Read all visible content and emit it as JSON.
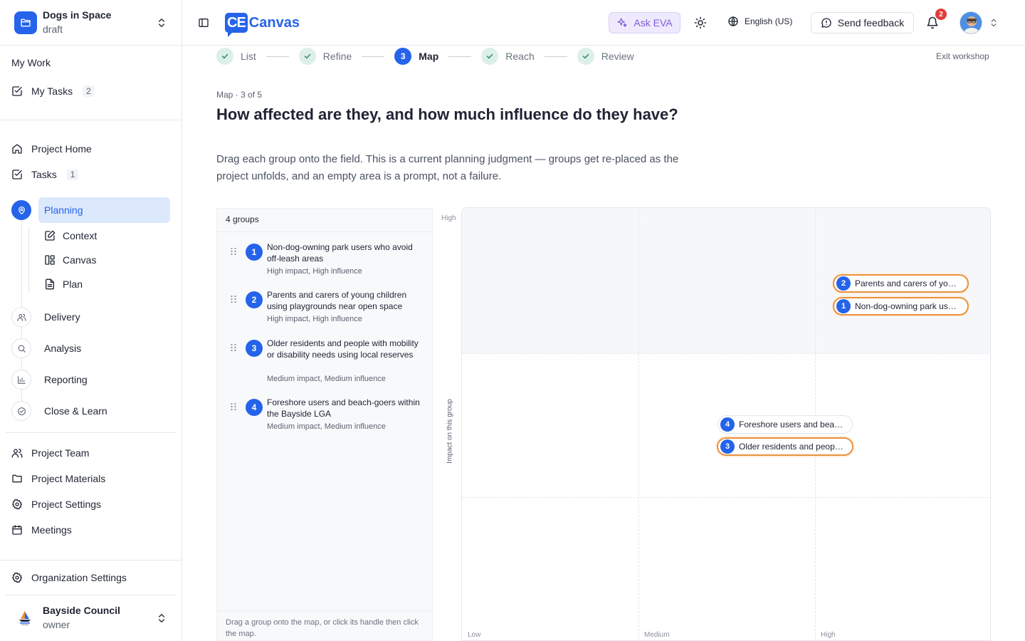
{
  "project": {
    "name": "Dogs in Space",
    "status": "draft"
  },
  "sidebar": {
    "section_label": "My Work",
    "my_tasks": {
      "label": "My Tasks",
      "count": "2"
    },
    "project_home": "Project Home",
    "tasks": {
      "label": "Tasks",
      "count": "1"
    },
    "phases": [
      {
        "label": "Planning",
        "icon": "map-pin-icon",
        "active": true
      },
      {
        "label": "Delivery",
        "icon": "users-icon"
      },
      {
        "label": "Analysis",
        "icon": "search-icon"
      },
      {
        "label": "Reporting",
        "icon": "bar-chart-icon"
      },
      {
        "label": "Close & Learn",
        "icon": "check-circle-icon"
      }
    ],
    "planning_children": [
      {
        "label": "Context",
        "icon": "edit-icon"
      },
      {
        "label": "Canvas",
        "icon": "layout-icon"
      },
      {
        "label": "Plan",
        "icon": "document-icon"
      }
    ],
    "links": [
      {
        "label": "Project Team",
        "icon": "users-icon"
      },
      {
        "label": "Project Materials",
        "icon": "folder-icon"
      },
      {
        "label": "Project Settings",
        "icon": "gear-icon"
      },
      {
        "label": "Meetings",
        "icon": "calendar-icon"
      }
    ],
    "org_settings": "Organization Settings",
    "org": {
      "name": "Bayside Council",
      "role": "owner"
    }
  },
  "topbar": {
    "logo_mark": "CE",
    "logo_text": "Canvas",
    "ask_eva": "Ask EVA",
    "language": "English (US)",
    "feedback": "Send feedback",
    "notifications": "2"
  },
  "stepper": {
    "steps": [
      {
        "label": "List",
        "state": "done"
      },
      {
        "label": "Refine",
        "state": "done"
      },
      {
        "label": "Map",
        "state": "current",
        "number": "3"
      },
      {
        "label": "Reach",
        "state": "done"
      },
      {
        "label": "Review",
        "state": "done"
      }
    ],
    "exit": "Exit workshop"
  },
  "page": {
    "crumb": "Map · 3 of 5",
    "title": "How affected are they, and how much influence do they have?",
    "description": "Drag each group onto the field. This is a current planning judgment — groups get re-placed as the project unfolds, and an empty area is a prompt, not a failure."
  },
  "groups_panel": {
    "header": "4 groups",
    "items": [
      {
        "number": "1",
        "name": "Non-dog-owning park users who avoid off-leash areas",
        "meta": "High impact, High influence"
      },
      {
        "number": "2",
        "name": "Parents and carers of young children using playgrounds near open space",
        "meta": "High impact, High influence"
      },
      {
        "number": "3",
        "name": "Older residents and people with mobility or disability needs using local reserves",
        "meta": "Medium impact, Medium influence"
      },
      {
        "number": "4",
        "name": "Foreshore users and beach-goers within the Bayside LGA",
        "meta": "Medium impact, Medium influence"
      }
    ],
    "footer": "Drag a group onto the map, or click its handle then click the map."
  },
  "map": {
    "y_axis_label": "Impact on this group",
    "y_high": "High",
    "x_ticks": [
      "Low",
      "Medium",
      "High"
    ],
    "selected_outline_color": "#e8913d",
    "accent_color": "#2563eb",
    "placements": [
      {
        "number": "2",
        "label": "Parents and carers of you…",
        "impact": "High",
        "influence": "High",
        "selected": true
      },
      {
        "number": "1",
        "label": "Non-dog-owning park use…",
        "impact": "High",
        "influence": "High",
        "selected": true
      },
      {
        "number": "4",
        "label": "Foreshore users and beac…",
        "impact": "Medium",
        "influence": "Medium",
        "selected": false
      },
      {
        "number": "3",
        "label": "Older residents and peopl…",
        "impact": "Medium",
        "influence": "Medium",
        "selected": true
      }
    ]
  }
}
